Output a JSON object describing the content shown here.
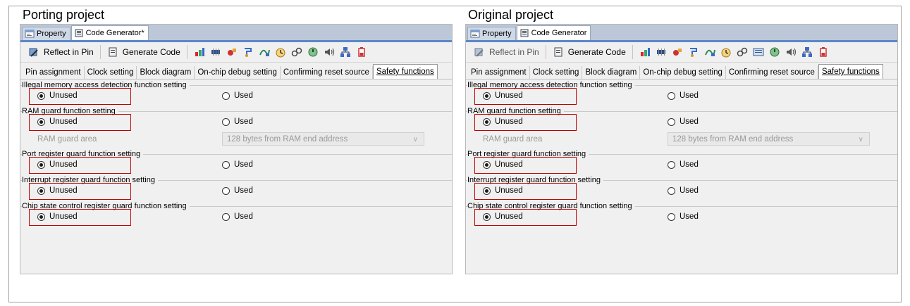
{
  "panels": [
    {
      "title": "Porting project",
      "tabs": [
        "Property",
        "Code Generator*"
      ],
      "toolbar": {
        "reflect": "Reflect in Pin",
        "generate": "Generate Code",
        "generate_access_key": ""
      },
      "subtabs": [
        "Pin assignment",
        "Clock setting",
        "Block diagram",
        "On-chip debug setting",
        "Confirming reset source",
        "Safety functions"
      ],
      "groups": [
        {
          "title": "Illegal memory access detection function setting",
          "unused": "Unused",
          "used": "Used"
        },
        {
          "title": "RAM guard function setting",
          "unused": "Unused",
          "used": "Used",
          "area_label": "RAM guard area",
          "area_value": "128 bytes from RAM end address"
        },
        {
          "title": "Port register guard function setting",
          "unused": "Unused",
          "used": "Used"
        },
        {
          "title": "Interrupt register guard function setting",
          "unused": "Unused",
          "used": "Used"
        },
        {
          "title": "Chip state control register guard function setting",
          "unused": "Unused",
          "used": "Used"
        }
      ]
    },
    {
      "title": "Original project",
      "tabs": [
        "Property",
        "Code Generator"
      ],
      "toolbar": {
        "reflect": "Reflect in Pin",
        "generate": "Generate Code"
      },
      "subtabs": [
        "Pin assignment",
        "Clock setting",
        "Block diagram",
        "On-chip debug setting",
        "Confirming reset source",
        "Safety functions"
      ],
      "groups": [
        {
          "title": "Illegal memory access detection function setting",
          "unused": "Unused",
          "used": "Used"
        },
        {
          "title": "RAM guard function setting",
          "unused": "Unused",
          "used": "Used",
          "area_label": "RAM guard area",
          "area_value": "128 bytes from RAM end address"
        },
        {
          "title": "Port register guard function setting",
          "unused": "Unused",
          "used": "Used"
        },
        {
          "title": "Interrupt register guard function setting",
          "unused": "Unused",
          "used": "Used"
        },
        {
          "title": "Chip state control register guard function setting",
          "unused": "Unused",
          "used": "Used"
        }
      ]
    }
  ],
  "selected_option": "Unused",
  "highlight_color": "#c00000",
  "accent_color": "#5b87c9"
}
